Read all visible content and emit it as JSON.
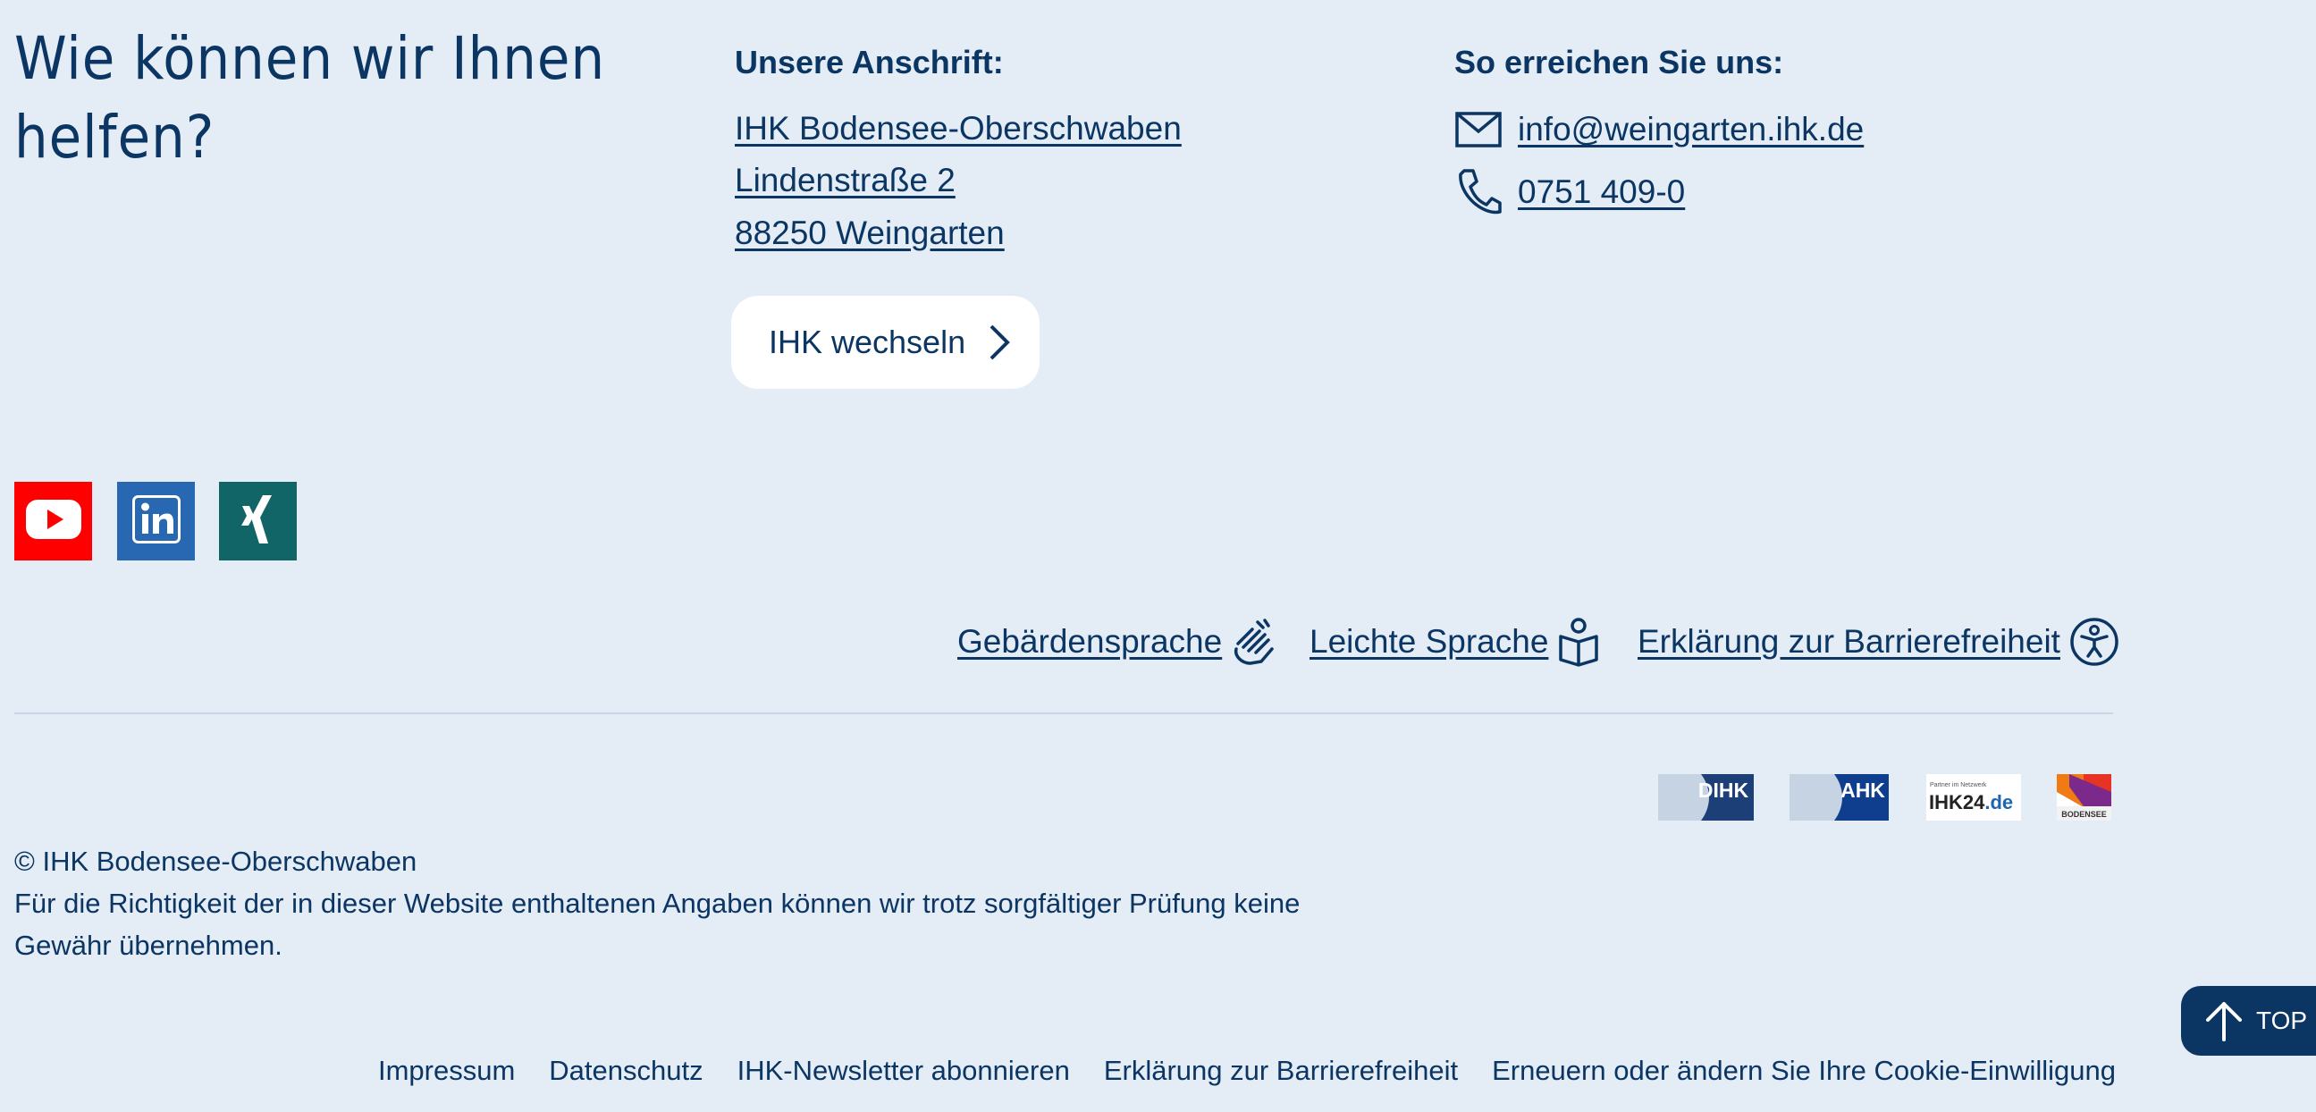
{
  "help": {
    "heading": "Wie können wir Ihnen helfen?"
  },
  "address": {
    "title": "Unsere Anschrift:",
    "lines": [
      "IHK Bodensee-Oberschwaben",
      "Lindenstraße 2",
      "88250 Weingarten"
    ],
    "switch_button": "IHK wechseln"
  },
  "contact": {
    "title": "So erreichen Sie uns:",
    "email": "info@weingarten.ihk.de",
    "phone": "0751 409-0"
  },
  "social": [
    {
      "name": "YouTube",
      "icon": "youtube-icon",
      "color": "#ff0000"
    },
    {
      "name": "LinkedIn",
      "icon": "linkedin-icon",
      "color": "#2867b2"
    },
    {
      "name": "XING",
      "icon": "xing-icon",
      "color": "#126567"
    }
  ],
  "accessibility_links": [
    {
      "label": "Gebärdensprache",
      "icon": "sign-language-icon"
    },
    {
      "label": "Leichte Sprache",
      "icon": "easy-language-icon"
    },
    {
      "label": "Erklärung zur Barrierefreiheit",
      "icon": "accessibility-icon"
    }
  ],
  "partner_logos": {
    "dihk": "DIHK",
    "ahk": "AHK",
    "ihk24": {
      "small": "Partner im Netzwerk",
      "main": "IHK24",
      "suffix": ".de"
    },
    "bodensee": "BODENSEE"
  },
  "copyright": {
    "line1": "© IHK Bodensee-Oberschwaben",
    "line2": "Für die Richtigkeit der in dieser Website enthaltenen Angaben können wir trotz sorgfältiger Prüfung keine Gewähr übernehmen."
  },
  "top_button": "TOP",
  "bottom_nav": [
    "Impressum",
    "Datenschutz",
    "IHK-Newsletter abonnieren",
    "Erklärung zur Barrierefreiheit",
    "Erneuern oder ändern Sie Ihre Cookie-Einwilligung"
  ],
  "colors": {
    "background": "#e4ecf5",
    "text": "#0b3563",
    "button_bg": "#ffffff",
    "top_button_bg": "#0b3563"
  }
}
